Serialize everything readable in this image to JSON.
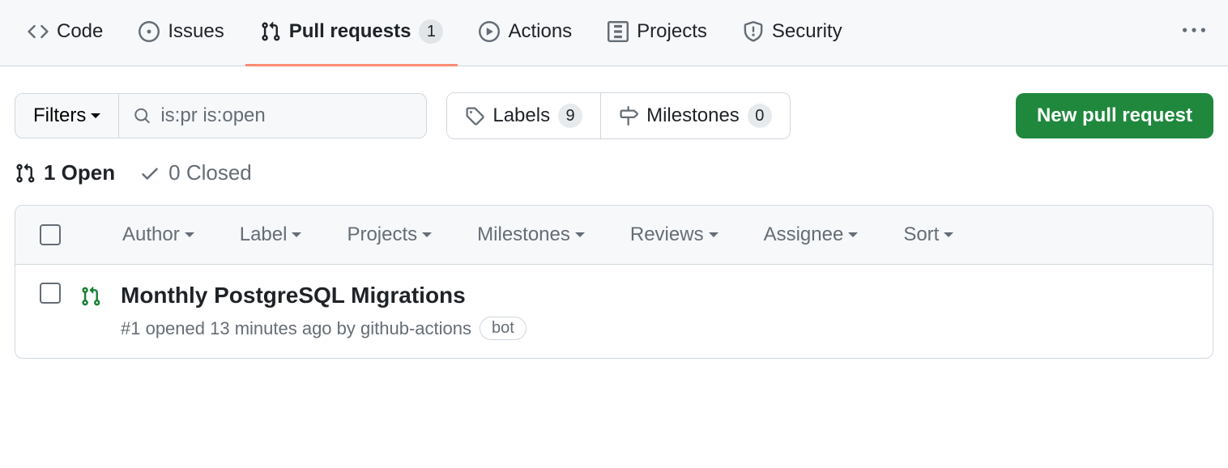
{
  "nav": {
    "code": "Code",
    "issues": "Issues",
    "pull_requests": "Pull requests",
    "pull_requests_count": "1",
    "actions": "Actions",
    "projects": "Projects",
    "security": "Security"
  },
  "toolbar": {
    "filters": "Filters",
    "search_value": "is:pr is:open",
    "labels": "Labels",
    "labels_count": "9",
    "milestones": "Milestones",
    "milestones_count": "0",
    "new_pr": "New pull request"
  },
  "status": {
    "open": "1 Open",
    "closed": "0 Closed"
  },
  "columns": {
    "author": "Author",
    "label": "Label",
    "projects": "Projects",
    "milestones": "Milestones",
    "reviews": "Reviews",
    "assignee": "Assignee",
    "sort": "Sort"
  },
  "rows": [
    {
      "title": "Monthly PostgreSQL Migrations",
      "meta": "#1 opened 13 minutes ago by github-actions",
      "badge": "bot"
    }
  ]
}
